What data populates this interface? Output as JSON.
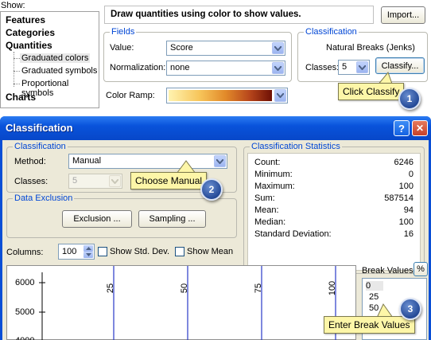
{
  "symbology": {
    "show_label": "Show:",
    "tree": [
      {
        "label": "Features"
      },
      {
        "label": "Categories"
      },
      {
        "label": "Quantities"
      },
      {
        "label": "Graduated colors"
      },
      {
        "label": "Graduated symbols"
      },
      {
        "label": "Proportional symbols"
      },
      {
        "label": "Charts"
      }
    ],
    "description": "Draw quantities using color to show values.",
    "import_label": "Import...",
    "fields": {
      "title": "Fields",
      "value_label": "Value:",
      "value": "Score",
      "normalization_label": "Normalization:",
      "normalization": "none"
    },
    "classification": {
      "title": "Classification",
      "method": "Natural Breaks (Jenks)",
      "classes_label": "Classes:",
      "classes": "5",
      "classify_label": "Classify..."
    },
    "color_ramp_label": "Color Ramp:"
  },
  "callouts": [
    {
      "text": "Click Classify",
      "badge": "1"
    },
    {
      "text": "Choose Manual",
      "badge": "2"
    },
    {
      "text": "Enter Break Values",
      "badge": "3"
    }
  ],
  "dialog": {
    "title": "Classification",
    "help_label": "?",
    "close_label": "✕",
    "classification": {
      "title": "Classification",
      "method_label": "Method:",
      "method": "Manual",
      "classes_label": "Classes:",
      "classes": "5"
    },
    "exclusion": {
      "title": "Data Exclusion",
      "exclusion_label": "Exclusion ...",
      "sampling_label": "Sampling ..."
    },
    "stats": {
      "title": "Classification Statistics",
      "rows": [
        {
          "label": "Count:",
          "value": "6246"
        },
        {
          "label": "Minimum:",
          "value": "0"
        },
        {
          "label": "Maximum:",
          "value": "100"
        },
        {
          "label": "Sum:",
          "value": "587514"
        },
        {
          "label": "Mean:",
          "value": "94"
        },
        {
          "label": "Median:",
          "value": "100"
        },
        {
          "label": "Standard Deviation:",
          "value": "16"
        }
      ]
    },
    "columns_label": "Columns:",
    "columns": "100",
    "show_std_dev": "Show Std. Dev.",
    "show_mean": "Show Mean",
    "histogram": {
      "y_ticks": [
        "6000",
        "5000",
        "4000"
      ],
      "break_labels": [
        "25",
        "50",
        "75",
        "100"
      ]
    },
    "break_values_label": "Break Values",
    "percent_label": "%",
    "break_values": [
      "0",
      "25",
      "50"
    ]
  }
}
